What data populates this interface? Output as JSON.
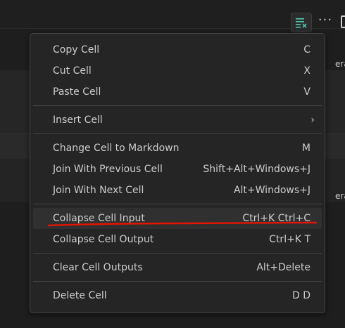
{
  "background": {
    "peek_text_1": "era",
    "peek_text_2": "era"
  },
  "toolbar": {
    "clear_outputs_icon": "clear-all-icon",
    "more_icon": "more-actions-icon",
    "more_label": "···"
  },
  "menu": {
    "groups": [
      [
        {
          "label": "Copy Cell",
          "shortcut": "C"
        },
        {
          "label": "Cut Cell",
          "shortcut": "X"
        },
        {
          "label": "Paste Cell",
          "shortcut": "V"
        }
      ],
      [
        {
          "label": "Insert Cell",
          "submenu": "›"
        }
      ],
      [
        {
          "label": "Change Cell to Markdown",
          "shortcut": "M"
        },
        {
          "label": "Join With Previous Cell",
          "shortcut": "Shift+Alt+Windows+J"
        },
        {
          "label": "Join With Next Cell",
          "shortcut": "Alt+Windows+J"
        }
      ],
      [
        {
          "label": "Collapse Cell Input",
          "shortcut": "Ctrl+K Ctrl+C"
        },
        {
          "label": "Collapse Cell Output",
          "shortcut": "Ctrl+K T"
        }
      ],
      [
        {
          "label": "Clear Cell Outputs",
          "shortcut": "Alt+Delete"
        }
      ],
      [
        {
          "label": "Delete Cell",
          "shortcut": "D D"
        }
      ]
    ]
  },
  "colors": {
    "accent_icon": "#4ec9b0",
    "annotation_red": "#e51400",
    "menu_bg": "#252526",
    "menu_text": "#cccccc"
  }
}
